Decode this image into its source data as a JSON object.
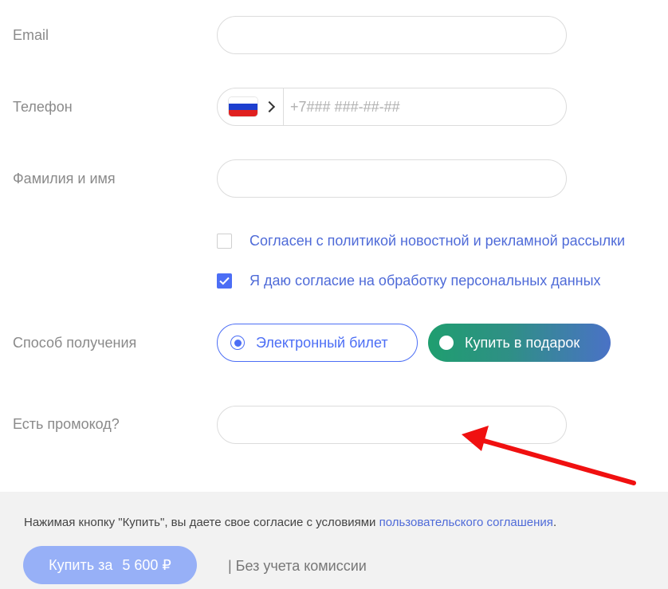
{
  "form": {
    "email": {
      "label": "Email",
      "value": "",
      "placeholder": ""
    },
    "phone": {
      "label": "Телефон",
      "country_flag": "russia-flag-icon",
      "value": "",
      "placeholder": "+7### ###-##-##"
    },
    "name": {
      "label": "Фамилия и имя",
      "value": "",
      "placeholder": ""
    },
    "consents": [
      {
        "text": "Согласен с политикой новостной и рекламной рассылки",
        "checked": false
      },
      {
        "text": "Я даю согласие на обработку персональных данных",
        "checked": true
      }
    ],
    "delivery": {
      "label": "Способ получения",
      "options": [
        {
          "text": "Электронный билет",
          "selected": true
        },
        {
          "text": "Купить в подарок",
          "selected": false
        }
      ]
    },
    "promo": {
      "label": "Есть промокод?",
      "value": "",
      "placeholder": ""
    }
  },
  "footer": {
    "terms_prefix": "Нажимая кнопку \"Купить\", вы даете свое согласие с условиями ",
    "terms_link": "пользовательского соглашения",
    "terms_suffix": ".",
    "buy_label": "Купить за",
    "buy_price": "5 600 ₽",
    "commission": "| Без учета комиссии"
  },
  "colors": {
    "accent": "#4c6ef5",
    "link": "#4f6bd8",
    "buy_button": "#97b0f7",
    "annotation_arrow": "#f01010"
  }
}
